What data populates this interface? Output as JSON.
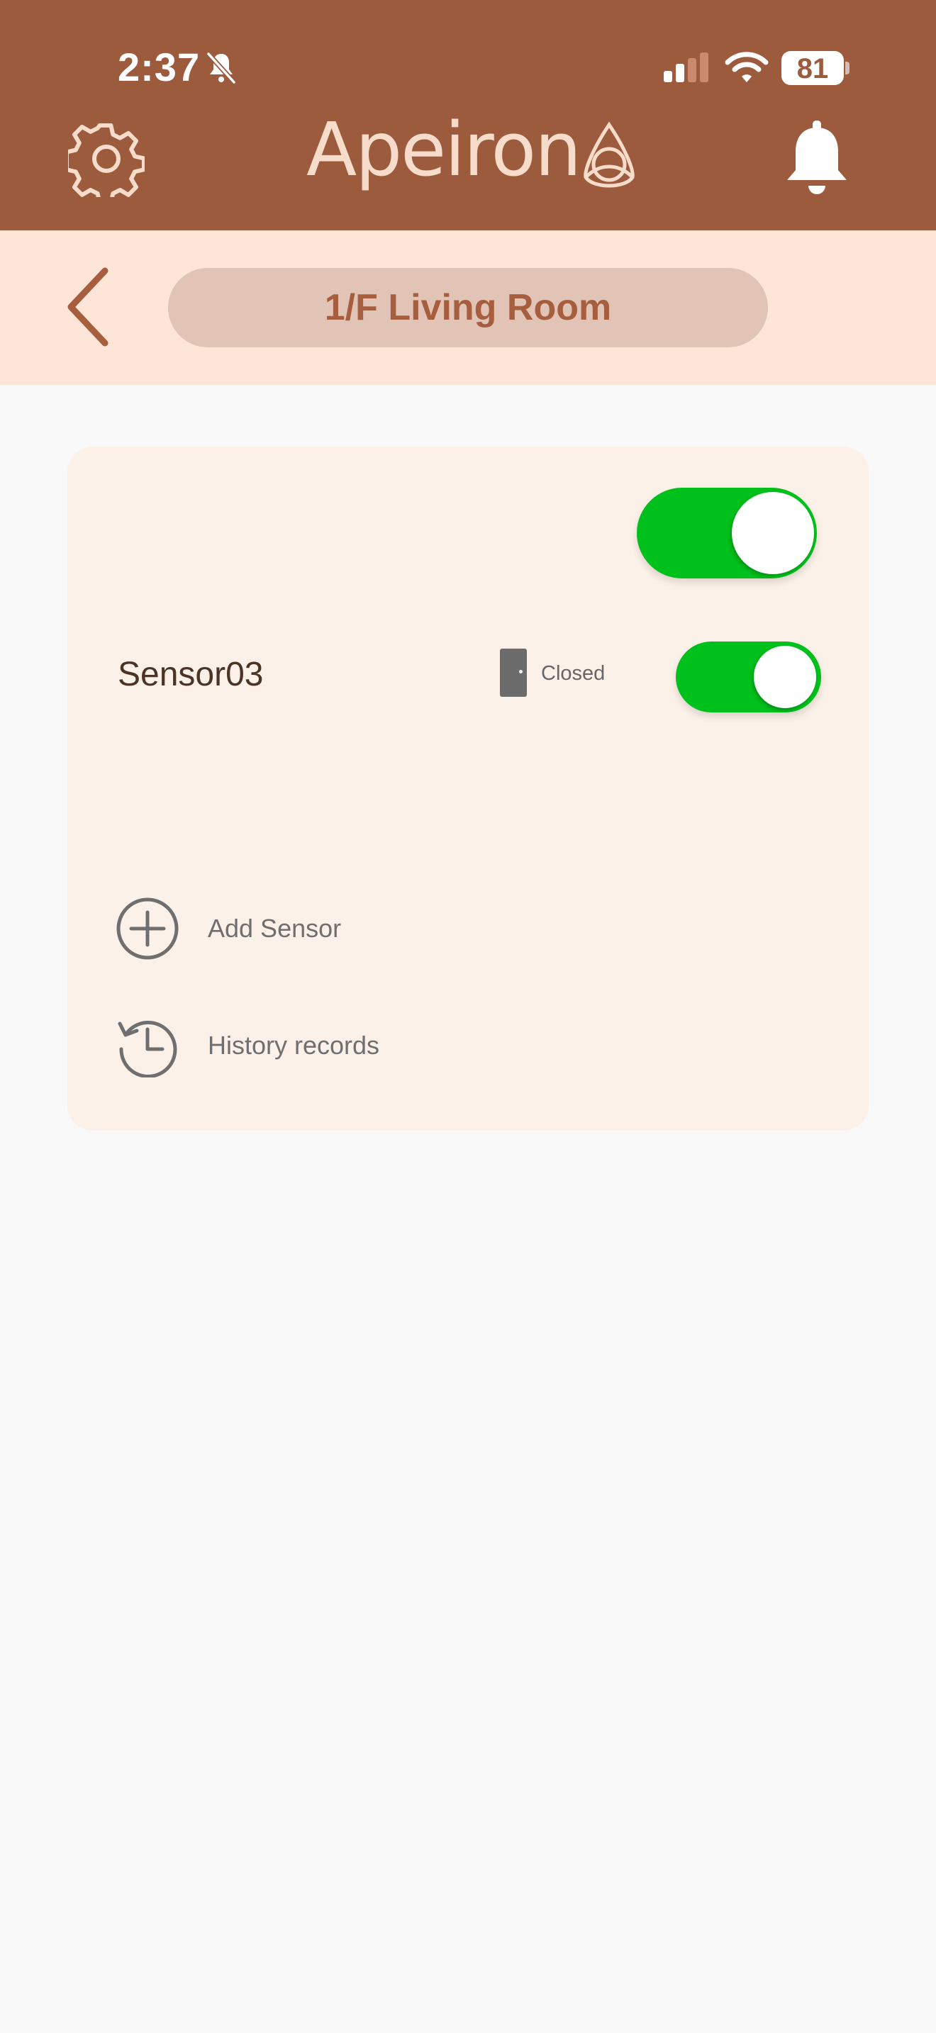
{
  "status_bar": {
    "time": "2:37",
    "battery": "81",
    "mute_icon": "bell-slash-icon",
    "signal_icon": "cellular-signal-icon",
    "wifi_icon": "wifi-icon"
  },
  "header": {
    "app_name": "Apeiron",
    "settings_icon": "gear-icon",
    "notifications_icon": "bell-icon",
    "logo_icon": "triquetra-icon"
  },
  "subheader": {
    "back_icon": "chevron-left-icon",
    "room_name": "1/F Living Room"
  },
  "card": {
    "master_toggle": {
      "on": true
    },
    "sensors": [
      {
        "name": "Sensor03",
        "status": "Closed",
        "status_icon": "door-icon",
        "enabled": true
      }
    ],
    "actions": {
      "add_sensor": "Add Sensor",
      "history": "History records"
    }
  },
  "colors": {
    "header_bg": "#9c5b3d",
    "subheader_bg": "#fde5d7",
    "pill_bg": "#e2c4b7",
    "accent_text": "#a75e3e",
    "toggle_on": "#00c11b",
    "card_bg": "#fcf1e9",
    "page_bg": "#f9f9f9"
  }
}
